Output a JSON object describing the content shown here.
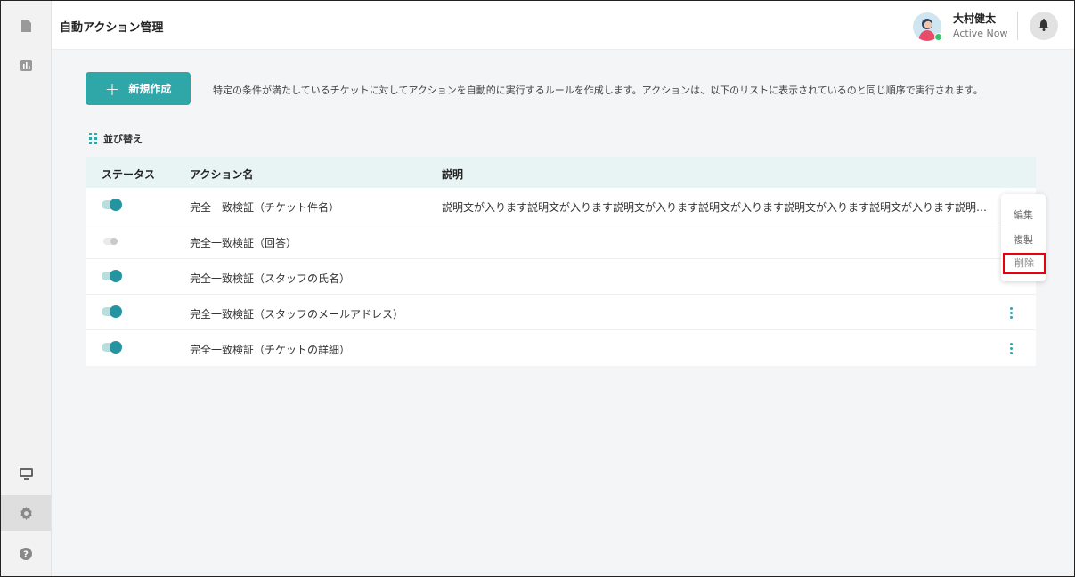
{
  "sidebar": {
    "items": [
      {
        "name": "document"
      },
      {
        "name": "chart"
      },
      {
        "name": "monitor"
      },
      {
        "name": "gear",
        "active": true
      },
      {
        "name": "help"
      }
    ]
  },
  "header": {
    "title": "自動アクション管理",
    "user_name": "大村健太",
    "user_status": "Active Now"
  },
  "main": {
    "create_button_label": "新規作成",
    "create_button_icon": "+",
    "intro_text": "特定の条件が満たしているチケットに対してアクションを自動的に実行するルールを作成します。アクションは、以下のリストに表示されているのと同じ順序で実行されます。",
    "sort_label": "並び替え",
    "table": {
      "headers": {
        "status": "ステータス",
        "name": "アクション名",
        "description": "説明"
      },
      "rows": [
        {
          "enabled": true,
          "name": "完全一致検証（チケット件名）",
          "description": "説明文が入ります説明文が入ります説明文が入ります説明文が入ります説明文が入ります説明文が入ります説明文が入ります説明文が入ります"
        },
        {
          "enabled": false,
          "name": "完全一致検証（回答）",
          "description": ""
        },
        {
          "enabled": true,
          "name": "完全一致検証（スタッフの氏名）",
          "description": ""
        },
        {
          "enabled": true,
          "name": "完全一致検証（スタッフのメールアドレス）",
          "description": ""
        },
        {
          "enabled": true,
          "name": "完全一致検証（チケットの詳細）",
          "description": ""
        }
      ]
    },
    "context_menu": {
      "items": [
        "編集",
        "複製",
        "削除"
      ],
      "highlighted": "削除"
    }
  },
  "colors": {
    "accent": "#2fa6a8",
    "highlight": "#e8000b"
  }
}
